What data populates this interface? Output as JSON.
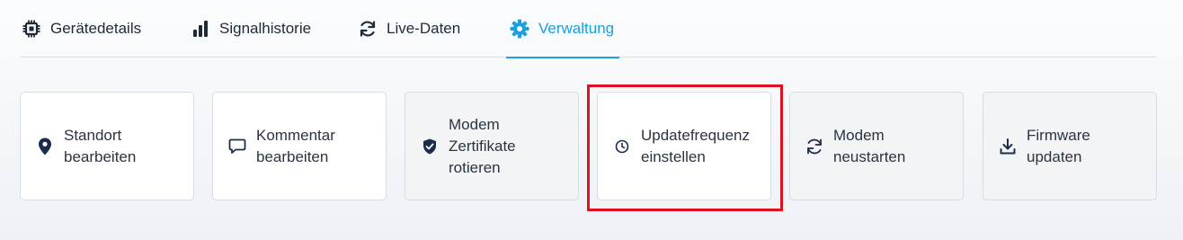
{
  "tabs": [
    {
      "label": "Gerätedetails",
      "icon": "chip-icon"
    },
    {
      "label": "Signalhistorie",
      "icon": "signal-bars-icon"
    },
    {
      "label": "Live-Daten",
      "icon": "refresh-icon"
    },
    {
      "label": "Verwaltung",
      "icon": "gear-icon",
      "active": true
    }
  ],
  "actions": [
    {
      "label": "Standort\nbearbeiten",
      "icon": "location-pin-icon"
    },
    {
      "label": "Kommentar\nbearbeiten",
      "icon": "comment-icon"
    },
    {
      "label": "Modem\nZertifikate\nrotieren",
      "icon": "shield-check-icon"
    },
    {
      "label": "Updatefrequenz\neinstellen",
      "icon": "clock-icon"
    },
    {
      "label": "Modem\nneustarten",
      "icon": "restart-icon"
    },
    {
      "label": "Firmware\nupdaten",
      "icon": "download-icon"
    }
  ],
  "colors": {
    "accent": "#1a9fe0",
    "highlight": "#e01020",
    "icon_dark": "#1c2c4c"
  }
}
